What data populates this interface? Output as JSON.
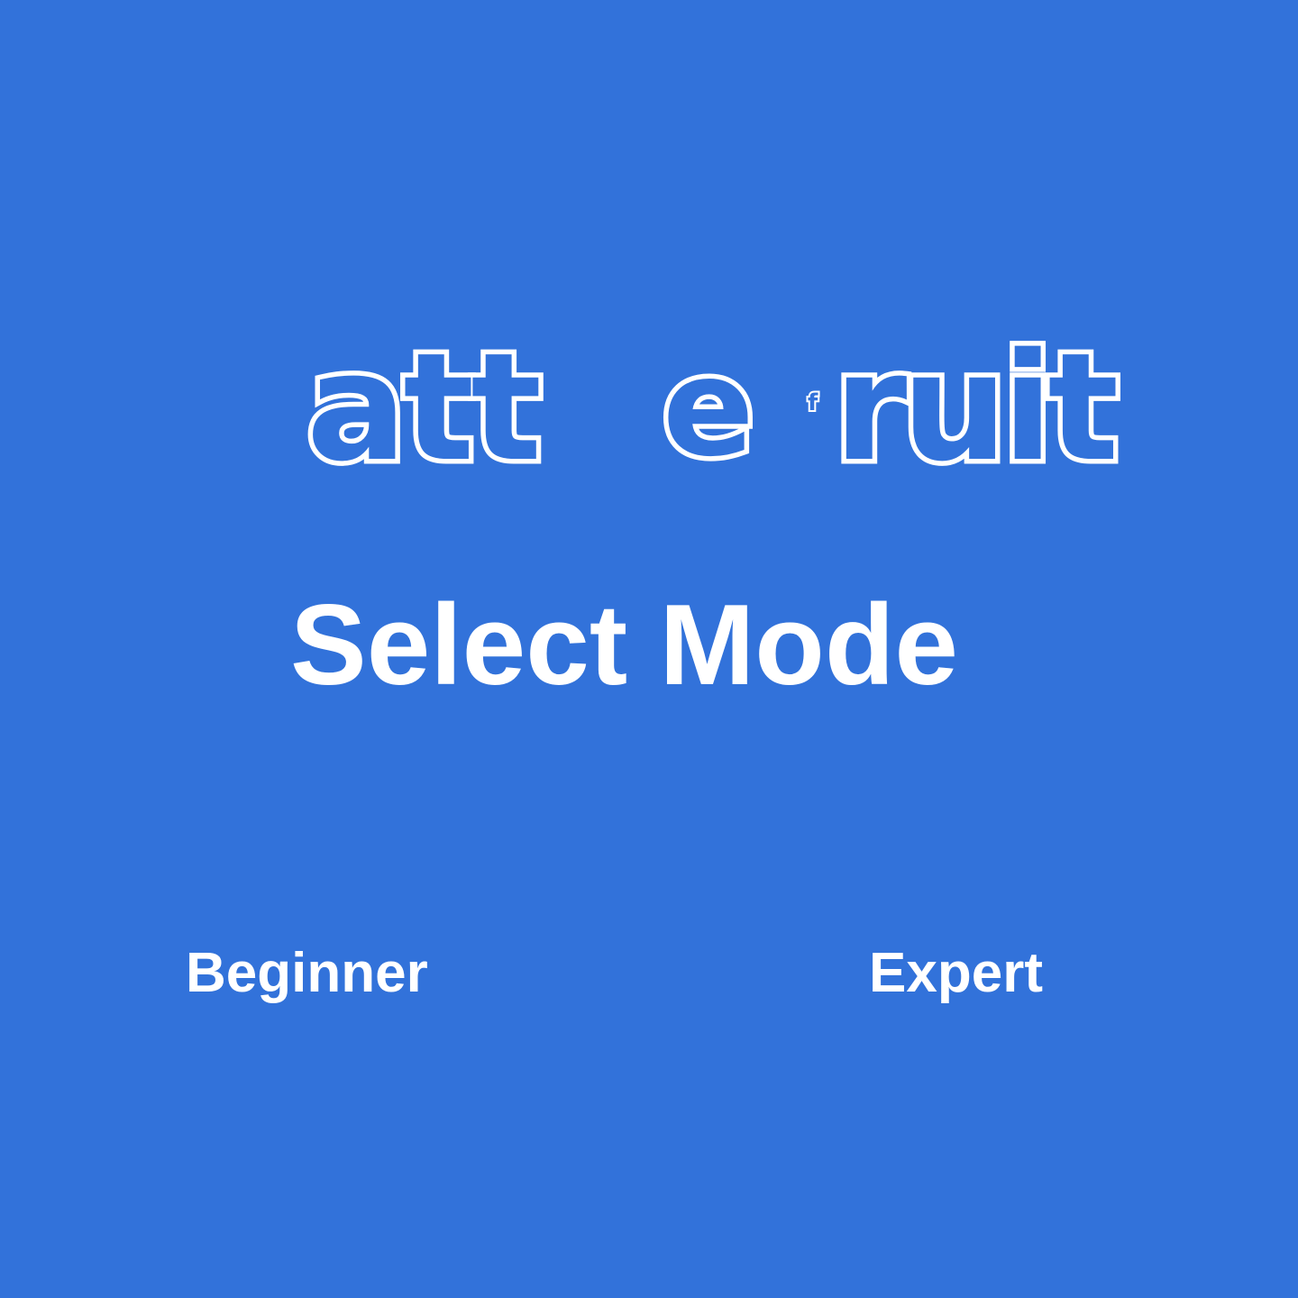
{
  "colors": {
    "background": "#3272da",
    "text": "#ffffff",
    "logo_fill": "#3272da",
    "logo_outline": "#ffffff"
  },
  "logo": {
    "parts": [
      "att",
      "e",
      "f",
      "ruit"
    ]
  },
  "title": "Select Mode",
  "modes": [
    {
      "label": "Beginner"
    },
    {
      "label": "Expert"
    }
  ]
}
